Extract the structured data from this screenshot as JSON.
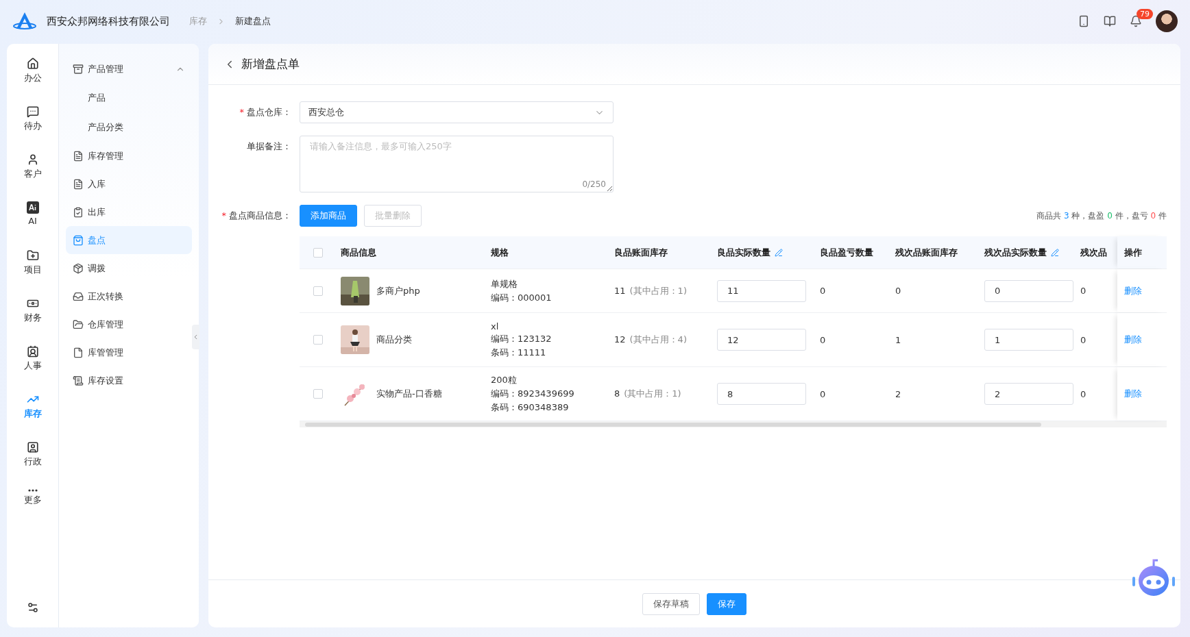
{
  "header": {
    "company": "西安众邦网络科技有限公司",
    "breadcrumb": [
      "库存",
      "新建盘点"
    ],
    "notifications": "79"
  },
  "rail": [
    {
      "label": "办公",
      "selected": false
    },
    {
      "label": "待办",
      "selected": false
    },
    {
      "label": "客户",
      "selected": false
    },
    {
      "label": "AI",
      "selected": false
    },
    {
      "label": "项目",
      "selected": false
    },
    {
      "label": "财务",
      "selected": false
    },
    {
      "label": "人事",
      "selected": false
    },
    {
      "label": "库存",
      "selected": true
    },
    {
      "label": "行政",
      "selected": false
    },
    {
      "label": "更多",
      "selected": false
    }
  ],
  "menu": [
    {
      "label": "产品管理",
      "selected": false,
      "expanded": true,
      "children": [
        {
          "label": "产品",
          "selected": false
        },
        {
          "label": "产品分类",
          "selected": false
        }
      ]
    },
    {
      "label": "库存管理",
      "selected": false
    },
    {
      "label": "入库",
      "selected": false
    },
    {
      "label": "出库",
      "selected": false
    },
    {
      "label": "盘点",
      "selected": true
    },
    {
      "label": "调拨",
      "selected": false
    },
    {
      "label": "正次转换",
      "selected": false
    },
    {
      "label": "仓库管理",
      "selected": false
    },
    {
      "label": "库管管理",
      "selected": false
    },
    {
      "label": "库存设置",
      "selected": false
    }
  ],
  "page": {
    "title": "新增盘点单"
  },
  "form": {
    "required_mark": "*",
    "warehouse": {
      "label": "盘点仓库：",
      "required": true,
      "value": "西安总仓"
    },
    "remark": {
      "label": "单据备注：",
      "required": false,
      "placeholder": "请输入备注信息，最多可输入250字",
      "counter": "0/250"
    },
    "goods": {
      "label": "盘点商品信息：",
      "required": true,
      "add": "添加商品",
      "batch_delete": "批量删除",
      "batch_disabled": true,
      "summary": [
        {
          "text": "商品共 "
        },
        {
          "text": "3",
          "color": "#1890ff"
        },
        {
          "text": " 种，盘盈 "
        },
        {
          "text": "0",
          "color": "#19be6b"
        },
        {
          "text": " 件，盘亏 "
        },
        {
          "text": "0",
          "color": "#ff4d4f"
        },
        {
          "text": " 件"
        }
      ]
    }
  },
  "table": {
    "all_checked": false,
    "columns": [
      {
        "label": "商品信息",
        "editable": false
      },
      {
        "label": "规格",
        "editable": false
      },
      {
        "label": "良品账面库存",
        "editable": false
      },
      {
        "label": "良品实际数量",
        "editable": true
      },
      {
        "label": "良品盈亏数量",
        "editable": false
      },
      {
        "label": "残次品账面库存",
        "editable": false
      },
      {
        "label": "残次品实际数量",
        "editable": true
      },
      {
        "label": "残次品",
        "editable": false
      },
      {
        "label": "操作",
        "editable": false
      }
    ],
    "rows": [
      {
        "selected": false,
        "name": "多商户php",
        "spec": [
          "单规格",
          "编码：000001"
        ],
        "book": "11",
        "occupied": "(其中占用：1)",
        "actual": "11",
        "diff": "0",
        "defect_book": "0",
        "defect_actual": "0",
        "defect_diff": "0",
        "action": "删除"
      },
      {
        "selected": false,
        "name": "商品分类",
        "spec": [
          "xl",
          "编码：123132",
          "条码：11111"
        ],
        "book": "12",
        "occupied": "(其中占用：4)",
        "actual": "12",
        "diff": "0",
        "defect_book": "1",
        "defect_actual": "1",
        "defect_diff": "0",
        "action": "删除"
      },
      {
        "selected": false,
        "name": "实物产品-口香糖",
        "spec": [
          "200粒",
          "编码：8923439699",
          "条码：690348389"
        ],
        "book": "8",
        "occupied": "(其中占用：1)",
        "actual": "8",
        "diff": "0",
        "defect_book": "2",
        "defect_actual": "2",
        "defect_diff": "0",
        "action": "删除"
      }
    ]
  },
  "footer": {
    "draft": "保存草稿",
    "save": "保存"
  }
}
